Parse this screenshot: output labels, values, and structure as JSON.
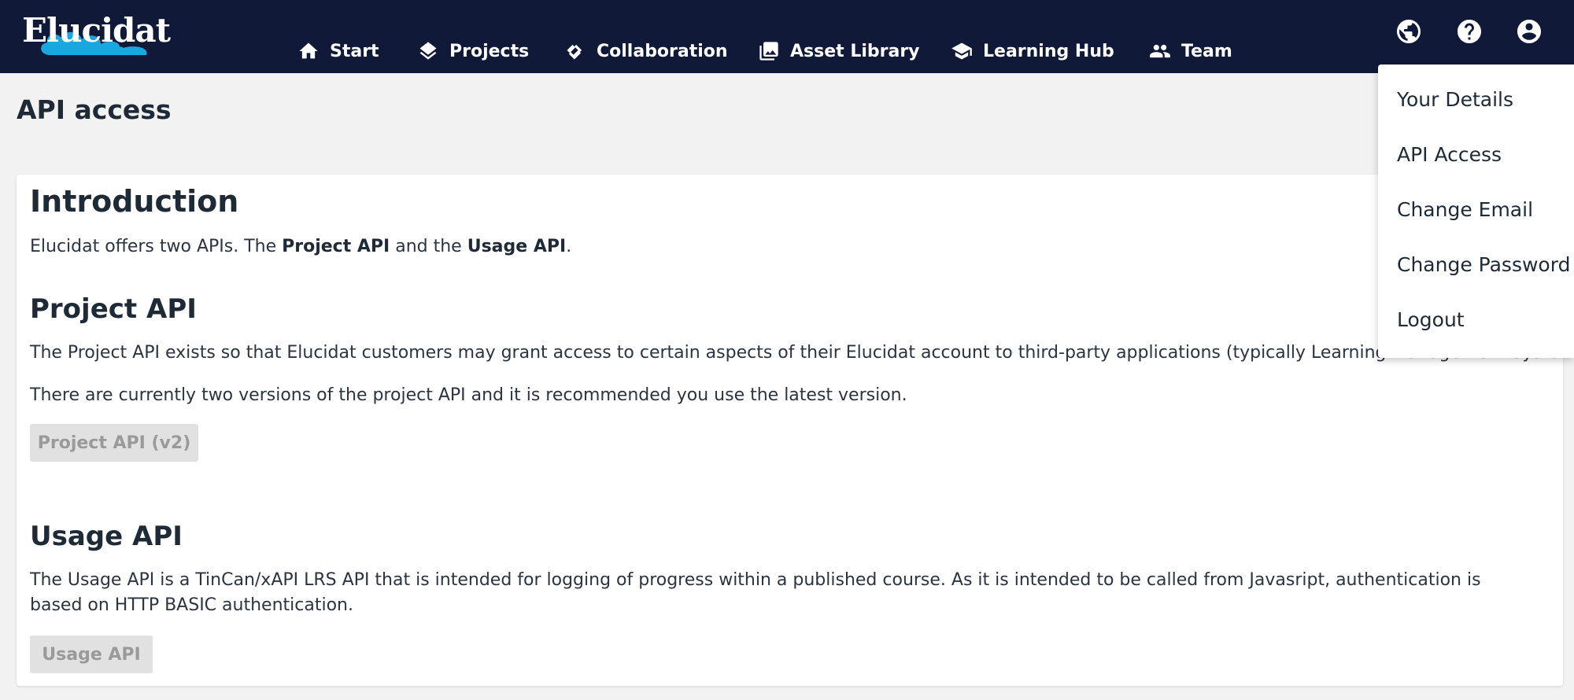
{
  "brand": {
    "logo_text": "Elucidat",
    "topbar_color": "#101a38",
    "logo_cloud_color": "#1aa7e0"
  },
  "nav": {
    "items": [
      {
        "label": "Start",
        "icon": "home-icon"
      },
      {
        "label": "Projects",
        "icon": "layers-icon"
      },
      {
        "label": "Collaboration",
        "icon": "handshake-icon"
      },
      {
        "label": "Asset Library",
        "icon": "images-icon"
      },
      {
        "label": "Learning Hub",
        "icon": "graduation-cap-icon"
      },
      {
        "label": "Team",
        "icon": "people-icon"
      }
    ],
    "right_icons": [
      "globe-icon",
      "help-icon",
      "account-icon"
    ]
  },
  "page": {
    "title": "API access"
  },
  "intro": {
    "heading": "Introduction",
    "text_before": "Elucidat offers two APIs. The ",
    "project_api_bold": "Project API",
    "text_middle": " and the ",
    "usage_api_bold": "Usage API",
    "text_after": "."
  },
  "project_api": {
    "heading": "Project API",
    "para1": "The Project API exists so that Elucidat customers may grant access to certain aspects of their Elucidat account to third-party applications (typically Learning Management Systems).",
    "para2": "There are currently two versions of the project API and it is recommended you use the latest version.",
    "button_label": "Project API (v2)"
  },
  "usage_api": {
    "heading": "Usage API",
    "para": "The Usage API is a TinCan/xAPI LRS API that is intended for logging of progress within a published course. As it is intended to be called from Javasript, authentication is based on HTTP BASIC authentication.",
    "button_label": "Usage API"
  },
  "account_menu": {
    "items": [
      "Your Details",
      "API Access",
      "Change Email",
      "Change Password",
      "Logout"
    ]
  }
}
